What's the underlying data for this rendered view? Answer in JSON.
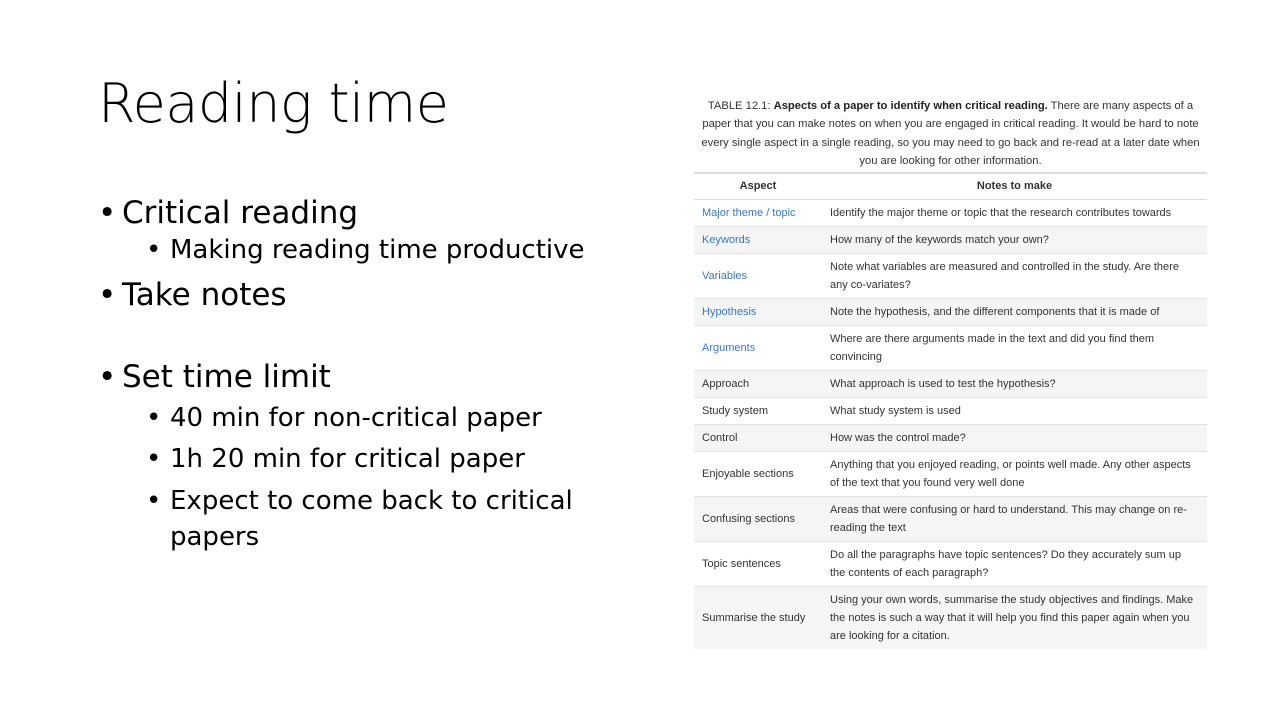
{
  "slide": {
    "title": "Reading time",
    "bullets": [
      {
        "text": "Critical reading",
        "sub": [
          "Making reading time productive"
        ]
      },
      {
        "text": "Take notes",
        "sub": []
      },
      {
        "text": "Set time limit",
        "sub": [
          "40 min for non-critical paper",
          "1h 20 min for critical paper",
          "Expect to come back to critical papers"
        ]
      }
    ]
  },
  "table": {
    "caption_prefix": "TABLE 12.1: ",
    "caption_bold": "Aspects of a paper to identify when critical reading.",
    "caption_rest": " There are many aspects of a paper that you can make notes on when you are engaged in critical reading. It would be hard to note every single aspect in a single reading, so you may need to go back and re-read at a later date when you are looking for other information.",
    "headers": [
      "Aspect",
      "Notes to make"
    ],
    "rows": [
      {
        "aspect": "Major theme / topic",
        "notes": "Identify the major theme or topic that the research contributes towards"
      },
      {
        "aspect": "Keywords",
        "notes": "How many of the keywords match your own?"
      },
      {
        "aspect": "Variables",
        "notes": "Note what variables are measured and controlled in the study. Are there any co-variates?"
      },
      {
        "aspect": "Hypothesis",
        "notes": "Note the hypothesis, and the different components that it is made of"
      },
      {
        "aspect": "Arguments",
        "notes": "Where are there arguments made in the text and did you find them convincing"
      },
      {
        "aspect": "Approach",
        "notes": "What approach is used to test the hypothesis?"
      },
      {
        "aspect": "Study system",
        "notes": "What study system is used"
      },
      {
        "aspect": "Control",
        "notes": "How was the control made?"
      },
      {
        "aspect": "Enjoyable sections",
        "notes": "Anything that you enjoyed reading, or points well made. Any other aspects of the text that you found very well done"
      },
      {
        "aspect": "Confusing sections",
        "notes": "Areas that were confusing or hard to understand. This may change on re-reading the text"
      },
      {
        "aspect": "Topic sentences",
        "notes": "Do all the paragraphs have topic sentences? Do they accurately sum up the contents of each paragraph?"
      },
      {
        "aspect": "Summarise the study",
        "notes": "Using your own words, summarise the study objectives and findings. Make the notes is such a way that it will help you find this paper again when you are looking for a citation."
      }
    ]
  },
  "colors": {
    "link": "#3a78c3",
    "text": "#333333",
    "row_alt": "#f5f5f5"
  }
}
